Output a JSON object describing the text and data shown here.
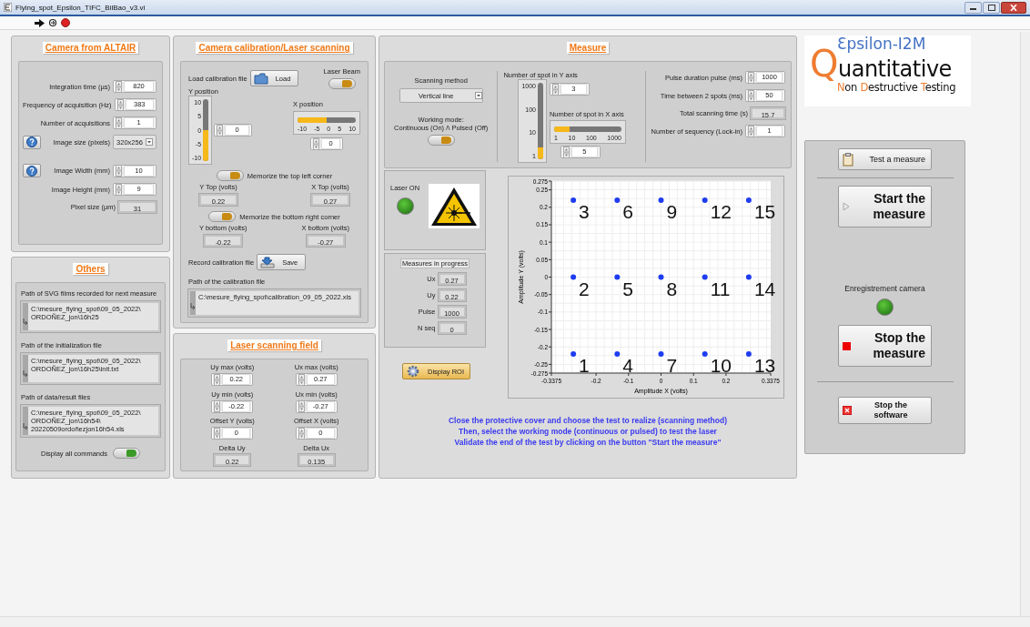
{
  "window": {
    "title": "Flying_spot_Epsilon_TIFC_BilBao_v3.vi"
  },
  "camera": {
    "title": "Camera from ALTAIR",
    "groups": [
      [
        {
          "label": "Integration time (µs)",
          "value": "820",
          "kind": "numeric"
        },
        {
          "label": "Frequency of acquisition (Hz)",
          "value": "383",
          "kind": "numeric"
        },
        {
          "label": "Number of acquisitions",
          "value": "1",
          "kind": "numeric"
        },
        {
          "label": "Image size (pixels)",
          "value": "320x256",
          "kind": "dropdown",
          "help": true
        }
      ],
      [
        {
          "label": "Image Width (mm)",
          "value": "10",
          "kind": "numeric",
          "help": true
        },
        {
          "label": "Image Height (mm)",
          "value": "9",
          "kind": "numeric"
        },
        {
          "label": "Pixel size (µm)",
          "value": "31",
          "kind": "indicator"
        }
      ]
    ]
  },
  "others": {
    "title": "Others",
    "paths": [
      {
        "label": "Path of SVG films recorded for next measure",
        "lines": [
          "C:\\mesure_flying_spot\\09_05_2022\\",
          "ORDOÑEZ_jon\\16h25"
        ]
      },
      {
        "label": "Path of the initialization file",
        "lines": [
          "C:\\mesure_flying_spot\\09_05_2022\\",
          "ORDOÑEZ_jon\\16h25\\init.txt"
        ]
      },
      {
        "label": "Path of data/result files",
        "lines": [
          "C:\\mesure_flying_spot\\09_05_2022\\",
          "ORDOÑEZ_jon\\16h54\\",
          "20220509ordoñezjon16h54.xls"
        ]
      }
    ],
    "display_all": {
      "label": "Display all commands",
      "on": true
    }
  },
  "calibration": {
    "title": "Camera calibration/Laser scanning",
    "load": {
      "label": "Load calibration file",
      "button": "Load"
    },
    "laser_beam": {
      "label": "Laser Beam",
      "on": true
    },
    "y_position": {
      "label": "Y position",
      "scale": [
        "10",
        "5",
        "0",
        "-5",
        "-10"
      ],
      "level": 0.5,
      "value": "0"
    },
    "x_position": {
      "label": "X position",
      "scale": [
        "-10",
        "-5",
        "0",
        "5",
        "10"
      ],
      "level": 0.5,
      "value": "0"
    },
    "corners": [
      {
        "label": "Memorize the top left corner",
        "on": true,
        "y": {
          "label": "Y Top (volts)",
          "value": "0.22"
        },
        "x": {
          "label": "X Top (volts)",
          "value": "0.27"
        }
      },
      {
        "label": "Memorize the bottom right corner",
        "on": true,
        "y": {
          "label": "Y bottom (volts)",
          "value": "-0.22"
        },
        "x": {
          "label": "X bottom (volts)",
          "value": "-0.27"
        }
      }
    ],
    "record": {
      "label": "Record calibration file",
      "button": "Save"
    },
    "path": {
      "label": "Path of the calibration file",
      "value": "C:\\mesure_flying_spot\\calibration_09_05_2022.xls"
    }
  },
  "scanning_field": {
    "title": "Laser scanning field",
    "fields": [
      {
        "label": "Uy max (volts)",
        "value": "0.22",
        "kind": "numeric"
      },
      {
        "label": "Ux max (volts)",
        "value": "0.27",
        "kind": "numeric"
      },
      {
        "label": "Uy min (volts)",
        "value": "-0.22",
        "kind": "numeric"
      },
      {
        "label": "Ux min (volts)",
        "value": "-0.27",
        "kind": "numeric"
      },
      {
        "label": "Offset Y (volts)",
        "value": "0",
        "kind": "numeric"
      },
      {
        "label": "Offset X (volts)",
        "value": "0",
        "kind": "numeric"
      },
      {
        "label": "Delta Uy",
        "value": "0.22",
        "kind": "indicator"
      },
      {
        "label": "Delta Ux",
        "value": "0.135",
        "kind": "indicator"
      }
    ]
  },
  "measure": {
    "title": "Measure",
    "scanning_method": {
      "label": "Scanning method",
      "value": "Vertical line"
    },
    "working_mode": {
      "label": [
        "Working mode:",
        "Continuous (On) /\\ Pulsed (Off)"
      ],
      "on": true
    },
    "spots_y": {
      "label": "Number of spot in Y axis",
      "scale": [
        "1000",
        "100",
        "10",
        "1"
      ],
      "level": 0.159,
      "value": "3"
    },
    "spots_x": {
      "label": "Number of spot in X axis",
      "scale": [
        "1",
        "10",
        "100",
        "1000"
      ],
      "level": 0.233,
      "value": "5"
    },
    "params": [
      {
        "label": "Pulse duration pulse (ms)",
        "value": "1000",
        "kind": "numeric"
      },
      {
        "label": "Time between 2 spots (ms)",
        "value": "50",
        "kind": "numeric"
      },
      {
        "label": "Total scanning time (s)",
        "value": "15.7",
        "kind": "indicator"
      },
      {
        "label": "Number of sequency (Lock-in)",
        "value": "1",
        "kind": "numeric"
      }
    ],
    "laser_on": {
      "label": "Laser ON",
      "on": true
    },
    "progress": {
      "title": "Measures in progress",
      "items": [
        {
          "label": "Ux",
          "value": "0.27"
        },
        {
          "label": "Uy",
          "value": "0.22"
        },
        {
          "label": "Pulse",
          "value": "1000"
        },
        {
          "label": "N seq",
          "value": "0"
        }
      ]
    },
    "display_roi": "Display ROI",
    "chart_data": {
      "type": "scatter",
      "grid": true,
      "xlabel": "Amplitude X (volts)",
      "ylabel": "Amplitude Y (volts)",
      "xlim": [
        -0.3375,
        0.3375
      ],
      "ylim": [
        -0.275,
        0.275
      ],
      "xticks": [
        -0.3375,
        -0.2,
        -0.1,
        0,
        0.1,
        0.2,
        0.3375
      ],
      "yticks": [
        0.275,
        0.25,
        0.2,
        0.15,
        0.1,
        0.05,
        0,
        -0.05,
        -0.1,
        -0.15,
        -0.2,
        -0.25,
        -0.275
      ],
      "x": [
        -0.27,
        -0.27,
        -0.27,
        -0.135,
        -0.135,
        -0.135,
        0,
        0,
        0,
        0.135,
        0.135,
        0.135,
        0.27,
        0.27,
        0.27
      ],
      "series": [
        {
          "color": "#1e3cf0",
          "values": [
            -0.22,
            0,
            0.22,
            -0.22,
            0,
            0.22,
            -0.22,
            0,
            0.22,
            -0.22,
            0,
            0.22,
            -0.22,
            0,
            0.22
          ]
        }
      ],
      "annotations": [
        {
          "x": -0.27,
          "y": -0.22,
          "text": "1"
        },
        {
          "x": -0.27,
          "y": 0,
          "text": "2"
        },
        {
          "x": -0.27,
          "y": 0.22,
          "text": "3"
        },
        {
          "x": -0.135,
          "y": -0.22,
          "text": "4"
        },
        {
          "x": -0.135,
          "y": 0,
          "text": "5"
        },
        {
          "x": -0.135,
          "y": 0.22,
          "text": "6"
        },
        {
          "x": 0,
          "y": -0.22,
          "text": "7"
        },
        {
          "x": 0,
          "y": 0,
          "text": "8"
        },
        {
          "x": 0,
          "y": 0.22,
          "text": "9"
        },
        {
          "x": 0.135,
          "y": -0.22,
          "text": "10"
        },
        {
          "x": 0.135,
          "y": 0,
          "text": "11"
        },
        {
          "x": 0.135,
          "y": 0.22,
          "text": "12"
        },
        {
          "x": 0.27,
          "y": -0.22,
          "text": "13"
        },
        {
          "x": 0.27,
          "y": 0,
          "text": "14"
        },
        {
          "x": 0.27,
          "y": 0.22,
          "text": "15"
        }
      ]
    },
    "instructions": [
      "Close the protective cover and choose the test to realize (scanning method)",
      "Then, select the working mode (continuous or pulsed) to test the laser",
      "Validate the end of the test by clicking on the button \"Start the measure\""
    ]
  },
  "logo": {
    "top": "Ɛpsilon-I2M",
    "middle": "Quantitative",
    "bottom": "Non Destructive Testing"
  },
  "controls": {
    "test": "Test a measure",
    "start": "Start the measure",
    "camera_led": {
      "label": "Enregistrement camera",
      "on": true
    },
    "stop": "Stop the measure",
    "quit": "Stop the software"
  }
}
